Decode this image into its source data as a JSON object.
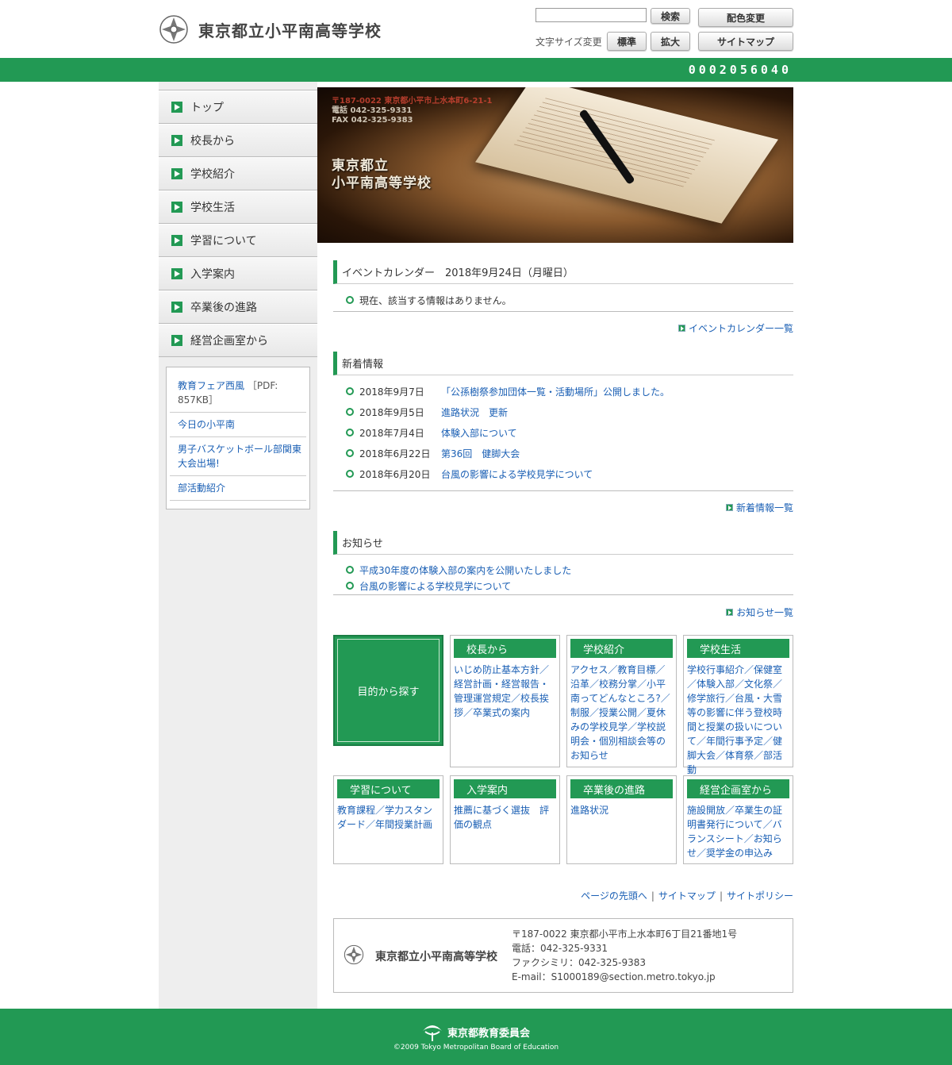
{
  "header": {
    "site_title": "東京都立小平南高等学校",
    "search_placeholder": "",
    "search_button": "検索",
    "color_button": "配色変更",
    "fontsize_label": "文字サイズ変更",
    "standard_button": "標準",
    "enlarge_button": "拡大",
    "sitemap_button": "サイトマップ",
    "counter": "0002056040"
  },
  "nav": {
    "items": [
      "トップ",
      "校長から",
      "学校紹介",
      "学校生活",
      "学習について",
      "入学案内",
      "卒業後の進路",
      "経営企画室から"
    ]
  },
  "side_links": {
    "item0": "教育フェア西風",
    "item0_pdf": "［PDF: 857KB］",
    "item1": "今日の小平南",
    "item2": "男子バスケットボール部関東大会出場!",
    "item3": "部活動紹介"
  },
  "hero": {
    "address_line1_prefix": "〒187-0022",
    "address_line1_rest": "東京都小平市上水本町6-21-1",
    "phone": "電話 042-325-9331",
    "fax": "FAX 042-325-9383",
    "title_line1": "東京都立",
    "title_line2": "小平南高等学校"
  },
  "event": {
    "heading": "イベントカレンダー　2018年9月24日（月曜日）",
    "empty": "現在、該当する情報はありません。",
    "more": "イベントカレンダー一覧"
  },
  "news": {
    "heading": "新着情報",
    "items": [
      {
        "date": "2018年9月7日",
        "title": "「公孫樹祭参加団体一覧・活動場所」公開しました。"
      },
      {
        "date": "2018年9月5日",
        "title": "進路状況　更新"
      },
      {
        "date": "2018年7月4日",
        "title": "体験入部について"
      },
      {
        "date": "2018年6月22日",
        "title": "第36回　健脚大会"
      },
      {
        "date": "2018年6月20日",
        "title": "台風の影響による学校見学について"
      }
    ],
    "more": "新着情報一覧"
  },
  "notice": {
    "heading": "お知らせ",
    "items": [
      "平成30年度の体験入部の案内を公開いたしました",
      "台風の影響による学校見学について"
    ],
    "more": "お知らせ一覧"
  },
  "categories": {
    "purpose": "目的から探す",
    "c1": {
      "title": "校長から",
      "body": "いじめ防止基本方針／経営計画・経営報告・管理運営規定／校長挨拶／卒業式の案内"
    },
    "c2": {
      "title": "学校紹介",
      "body": "アクセス／教育目標／沿革／校務分掌／小平南ってどんなところ?／制服／授業公開／夏休みの学校見学／学校説明会・個別相談会等のお知らせ"
    },
    "c3": {
      "title": "学校生活",
      "body": "学校行事紹介／保健室／体験入部／文化祭／修学旅行／台風・大雪等の影響に伴う登校時間と授業の扱いについて／年間行事予定／健脚大会／体育祭／部活動"
    },
    "c4": {
      "title": "学習について",
      "body": "教育課程／学力スタンダード／年間授業計画"
    },
    "c5": {
      "title": "入学案内",
      "body": "推薦に基づく選抜　評価の観点"
    },
    "c6": {
      "title": "卒業後の進路",
      "body": "進路状況"
    },
    "c7": {
      "title": "経営企画室から",
      "body": "施設開放／卒業生の証明書発行について／バランスシート／お知らせ／奨学金の申込み"
    }
  },
  "footer": {
    "link_top": "ページの先頭へ",
    "link_sitemap": "サイトマップ",
    "link_policy": "サイトポリシー",
    "school_name": "東京都立小平南高等学校",
    "address": "〒187-0022 東京都小平市上水本町6丁目21番地1号",
    "tel": "電話：042-325-9331",
    "fax": "ファクシミリ：042-325-9383",
    "email": "E-mail：S1000189@section.metro.tokyo.jp",
    "board": "東京都教育委員会",
    "copyright": "©2009 Tokyo Metropolitan Board of Education"
  },
  "colors": {
    "brand_green": "#229954",
    "link_blue": "#1a5fb4"
  }
}
